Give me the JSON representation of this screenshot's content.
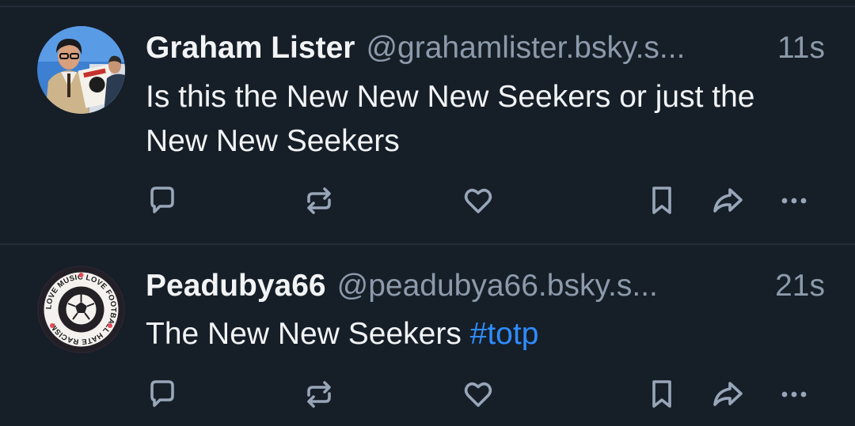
{
  "posts": [
    {
      "author_name": "Graham Lister",
      "handle": "@grahamlister.bsky.s...",
      "time": "11s",
      "text_plain": "Is this the New New New Seekers or just the New New Seekers",
      "hashtag": "",
      "avatar_icon": "photo-avatar"
    },
    {
      "author_name": "Peadubya66",
      "handle": "@peadubya66.bsky.s...",
      "time": "21s",
      "text_plain": "The New New Seekers ",
      "hashtag": "#totp",
      "avatar_text": "LOVE MUSIC LOVE FOOTBALL HATE RACISM",
      "avatar_icon": "football-badge-avatar"
    }
  ],
  "action_icons": [
    "reply-icon",
    "repost-icon",
    "like-icon",
    "bookmark-icon",
    "share-icon",
    "more-icon"
  ],
  "colors": {
    "background": "#161e27",
    "divider": "#222c38",
    "text": "#f1f3f5",
    "muted": "#8c9aab",
    "link": "#2f8cff",
    "icon": "#97a6b8"
  }
}
